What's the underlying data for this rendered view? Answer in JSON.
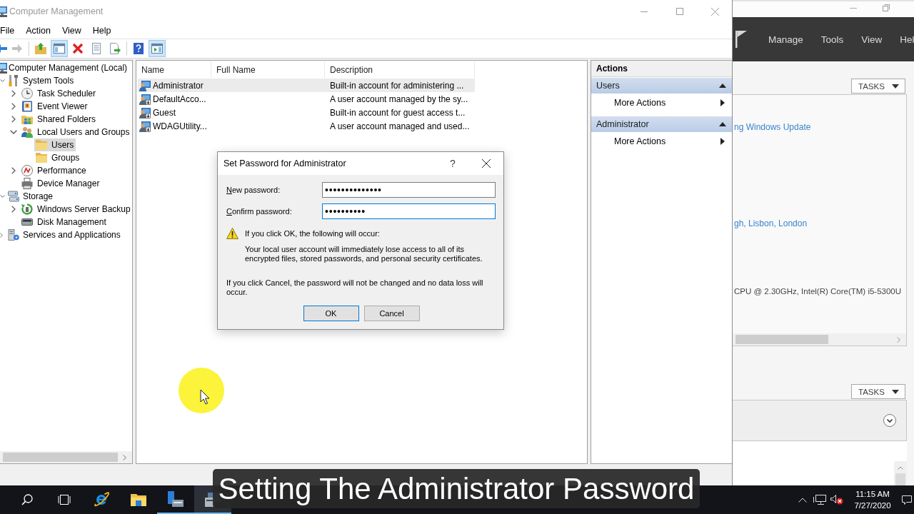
{
  "window": {
    "title": "Computer Management",
    "active": false
  },
  "menu": [
    "File",
    "Action",
    "View",
    "Help"
  ],
  "toolbar": {
    "groups": [
      [
        {
          "kind": "back",
          "disabled": false,
          "pressed": false
        },
        {
          "kind": "forward",
          "disabled": true,
          "pressed": false
        }
      ],
      [
        {
          "kind": "up",
          "disabled": false,
          "pressed": false
        },
        {
          "kind": "console-tree",
          "disabled": false,
          "pressed": true
        },
        {
          "kind": "delete",
          "disabled": false,
          "pressed": false
        },
        {
          "kind": "properties",
          "disabled": false,
          "pressed": false
        },
        {
          "kind": "export",
          "disabled": false,
          "pressed": false
        }
      ],
      [
        {
          "kind": "help",
          "disabled": false,
          "pressed": false
        },
        {
          "kind": "action-pane",
          "disabled": false,
          "pressed": true
        }
      ]
    ]
  },
  "tree": {
    "items": [
      {
        "label": "Computer Management (Local)",
        "selected": false,
        "children": [
          {
            "label": "System Tools",
            "expanded": true,
            "selected": false,
            "children": [
              {
                "label": "Task Scheduler",
                "expanded": false,
                "selected": false
              },
              {
                "label": "Event Viewer",
                "expanded": false,
                "selected": false
              },
              {
                "label": "Shared Folders",
                "expanded": false,
                "selected": false
              },
              {
                "label": "Local Users and Groups",
                "expanded": true,
                "selected": false,
                "children": [
                  {
                    "label": "Users",
                    "selected": true
                  },
                  {
                    "label": "Groups",
                    "selected": false
                  }
                ]
              },
              {
                "label": "Performance",
                "expanded": false,
                "selected": false
              },
              {
                "label": "Device Manager",
                "selected": false
              }
            ]
          },
          {
            "label": "Storage",
            "expanded": true,
            "selected": false,
            "children": [
              {
                "label": "Windows Server Backup",
                "expanded": false,
                "selected": false
              },
              {
                "label": "Disk Management",
                "selected": false
              }
            ]
          },
          {
            "label": "Services and Applications",
            "expanded": false,
            "selected": false
          }
        ]
      }
    ]
  },
  "list": {
    "columns": [
      "Name",
      "Full Name",
      "Description"
    ],
    "rows": [
      {
        "name": "Administrator",
        "description": "Built-in account for administering ...",
        "selected": true,
        "disabled": false
      },
      {
        "name": "DefaultAcco...",
        "description": "A user account managed by the sy...",
        "selected": false,
        "disabled": true
      },
      {
        "name": "Guest",
        "description": "Built-in account for guest access t...",
        "selected": false,
        "disabled": true
      },
      {
        "name": "WDAGUtility...",
        "description": "A user account managed and used...",
        "selected": false,
        "disabled": true
      }
    ]
  },
  "actions": {
    "title": "Actions",
    "sections": [
      {
        "title": "Users",
        "expanded": true,
        "items": [
          "More Actions"
        ]
      },
      {
        "title": "Administrator",
        "expanded": true,
        "items": [
          "More Actions"
        ]
      }
    ]
  },
  "dialog": {
    "title": "Set Password for Administrator",
    "help": "?",
    "fields": [
      {
        "label": "New password:",
        "value": "••••••••••••••",
        "focused": false,
        "access_key_shown": true
      },
      {
        "label": "Confirm password:",
        "value": "••••••••••",
        "focused": true,
        "access_key_shown": true
      }
    ],
    "warning": {
      "heading": "If you click OK, the following will occur:",
      "text": "Your local user account will immediately lose access to all of its encrypted files, stored passwords, and personal security certificates."
    },
    "note": "If you click Cancel, the password will not be changed and no data loss will occur.",
    "buttons": [
      {
        "label": "OK",
        "default": true
      },
      {
        "label": "Cancel",
        "default": false
      }
    ]
  },
  "server_manager": {
    "menu": [
      "Manage",
      "Tools",
      "View",
      "Hel"
    ],
    "panels": [
      {
        "tasks": "TASKS",
        "expanded": true,
        "lines": [
          {
            "kind": "link",
            "text": "ng Windows Update"
          },
          {
            "kind": "link",
            "text": "gh, Lisbon, London"
          },
          {
            "kind": "text",
            "text": "CPU @ 2.30GHz, Intel(R) Core(TM) i5-5300U"
          }
        ]
      },
      {
        "tasks": "TASKS",
        "expanded": false
      }
    ]
  },
  "taskbar": {
    "apps": [
      {
        "kind": "search",
        "running": false,
        "active": false
      },
      {
        "kind": "task-view",
        "running": false,
        "active": false
      },
      {
        "kind": "browser",
        "running": false,
        "active": false
      },
      {
        "kind": "file-explorer",
        "running": false,
        "active": false
      },
      {
        "kind": "server-manager",
        "running": true,
        "active": false
      },
      {
        "kind": "computer-management",
        "running": true,
        "active": true
      }
    ],
    "clock": {
      "time": "11:15 AM",
      "date": "7/27/2020"
    }
  },
  "caption": "Setting The Administrator Password"
}
